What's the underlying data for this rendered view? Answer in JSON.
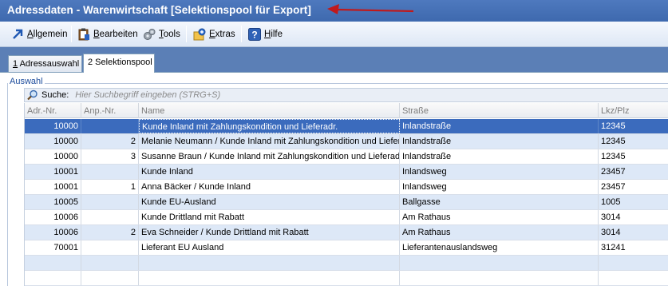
{
  "window": {
    "title": "Adressdaten - Warenwirtschaft [Selektionspool für Export]"
  },
  "toolbar": {
    "items": [
      {
        "label_underline": "A",
        "label_rest": "llgemein",
        "icon": "arrow-up-right-icon"
      },
      {
        "label_underline": "B",
        "label_rest": "earbeiten",
        "icon": "clipboard-icon"
      },
      {
        "label_underline": "T",
        "label_rest": "ools",
        "icon": "gears-icon"
      },
      {
        "label_underline": "E",
        "label_rest": "xtras",
        "icon": "extras-icon"
      },
      {
        "label_underline": "H",
        "label_rest": "ilfe",
        "icon": "help-icon"
      }
    ]
  },
  "tabs": [
    {
      "label_underline": "1",
      "label_rest": " Adressauswahl",
      "active": false
    },
    {
      "label_underline": "",
      "label_rest": "2 Selektionspool",
      "active": true
    }
  ],
  "group": {
    "label": "Auswahl"
  },
  "search": {
    "label": "Suche:",
    "placeholder": "Hier Suchbegriff eingeben (STRG+S)"
  },
  "table": {
    "columns": [
      "Adr.-Nr.",
      "Anp.-Nr.",
      "Name",
      "Straße",
      "Lkz/Plz"
    ],
    "rows": [
      {
        "adr": "10000",
        "anp": "",
        "name": "Kunde Inland mit Zahlungskondition und Lieferadr.",
        "strasse": "Inlandstraße",
        "plz": "12345"
      },
      {
        "adr": "10000",
        "anp": "2",
        "name": "Melanie Neumann / Kunde Inland mit Zahlungskondition und Lieferadr.",
        "strasse": "Inlandstraße",
        "plz": "12345"
      },
      {
        "adr": "10000",
        "anp": "3",
        "name": "Susanne Braun / Kunde Inland mit Zahlungskondition und Lieferadr.",
        "strasse": "Inlandstraße",
        "plz": "12345"
      },
      {
        "adr": "10001",
        "anp": "",
        "name": "Kunde Inland",
        "strasse": "Inlandsweg",
        "plz": "23457"
      },
      {
        "adr": "10001",
        "anp": "1",
        "name": "Anna Bäcker / Kunde Inland",
        "strasse": "Inlandsweg",
        "plz": "23457"
      },
      {
        "adr": "10005",
        "anp": "",
        "name": "Kunde EU-Ausland",
        "strasse": "Ballgasse",
        "plz": "1005"
      },
      {
        "adr": "10006",
        "anp": "",
        "name": "Kunde Drittland mit Rabatt",
        "strasse": "Am Rathaus",
        "plz": "3014"
      },
      {
        "adr": "10006",
        "anp": "2",
        "name": "Eva Schneider / Kunde Drittland mit Rabatt",
        "strasse": "Am Rathaus",
        "plz": "3014"
      },
      {
        "adr": "70001",
        "anp": "",
        "name": "Lieferant EU Ausland",
        "strasse": "Lieferantenauslandsweg",
        "plz": "31241"
      }
    ],
    "selected_row": 0
  },
  "colors": {
    "titlebar": "#4471b8",
    "selection": "#3b6bbd",
    "row_alt": "#dde8f7",
    "annotation_arrow": "#c0191b"
  }
}
